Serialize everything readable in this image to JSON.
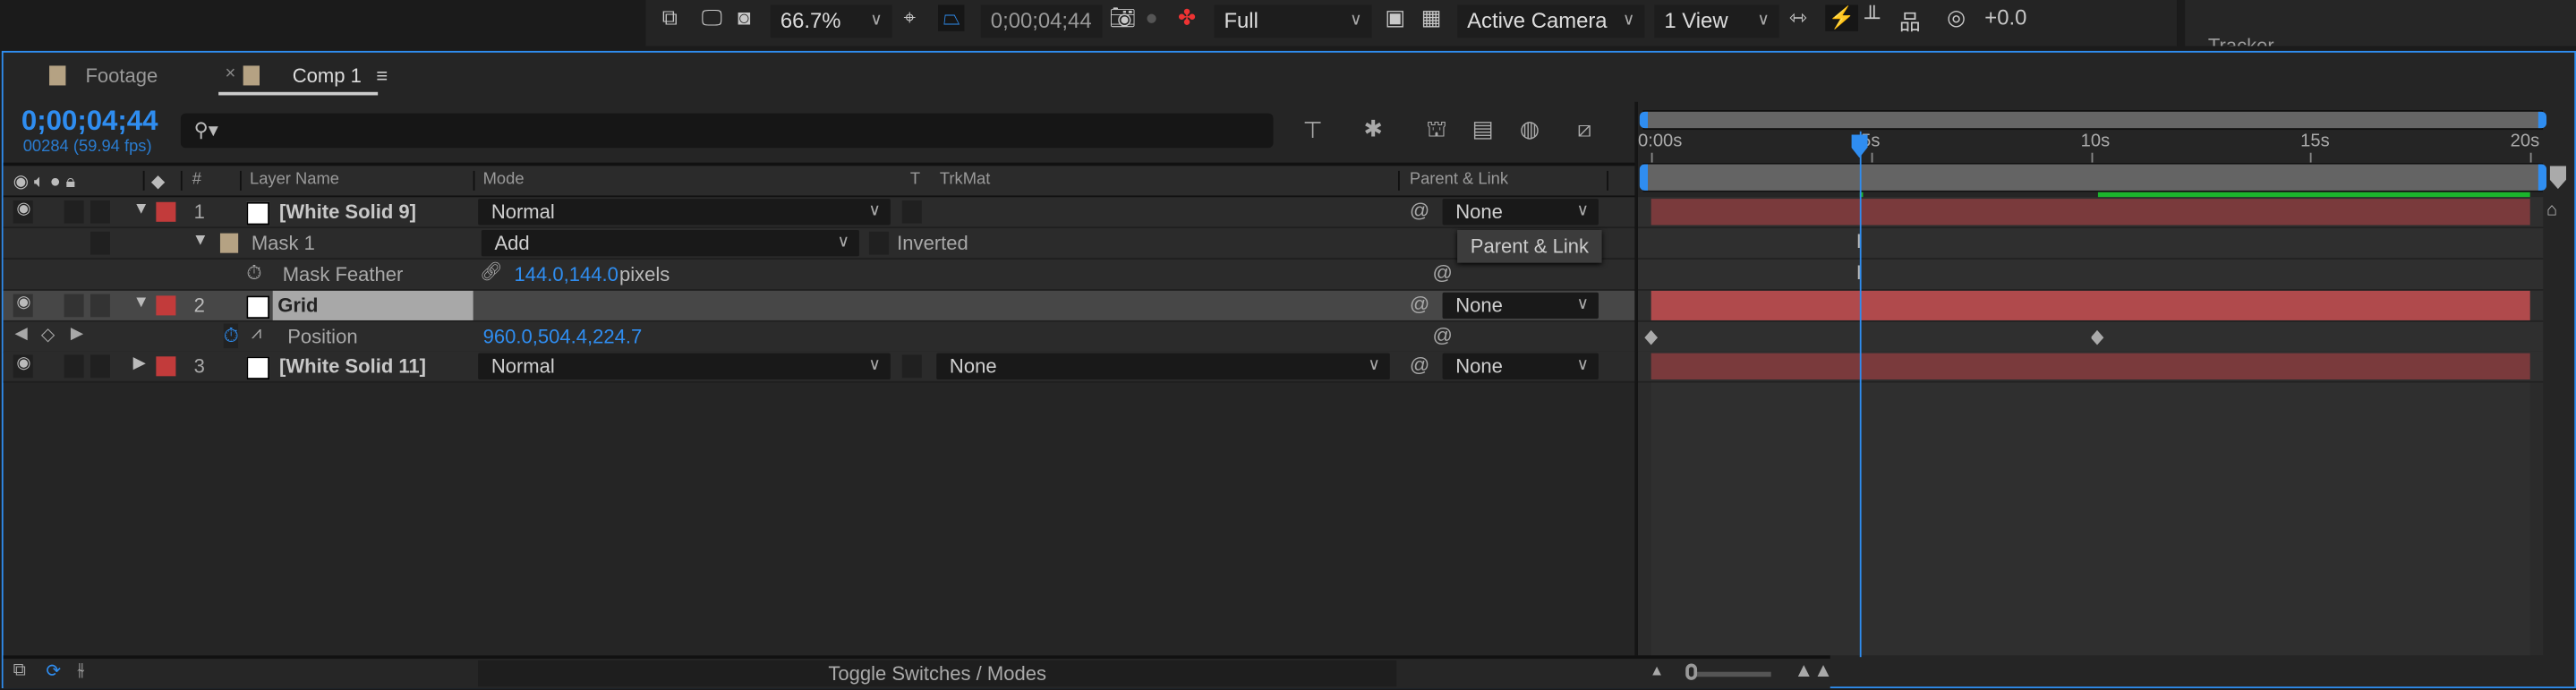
{
  "viewer_toolbar": {
    "zoom": "66.7%",
    "timecode": "0;00;04;44",
    "resolution": "Full",
    "camera": "Active Camera",
    "views": "1 View",
    "exposure": "+0.0",
    "icons": [
      "always-preview-icon",
      "monitor-icon",
      "mask-visibility-icon",
      "region-of-interest-icon",
      "transparency-grid-icon",
      "snapshot-icon",
      "show-snapshot-icon",
      "color-channels-icon",
      "toggle-pixel-aspect-icon",
      "checkerboard-icon",
      "3d-view-icon",
      "fast-previews-icon",
      "timeline-icon",
      "flowchart-icon",
      "exposure-icon"
    ]
  },
  "right_panel": {
    "title": "Tracker"
  },
  "tabs": [
    {
      "label": "Footage",
      "swatch": "#b5a283",
      "active": false
    },
    {
      "label": "Comp 1",
      "swatch": "#b5a283",
      "active": true,
      "close": "×",
      "menu": "≡"
    }
  ],
  "timecode": {
    "current": "0;00;04;44",
    "frames": "00284 (59.94 fps)"
  },
  "search": {
    "placeholder": "",
    "value": ""
  },
  "columns": {
    "hash": "#",
    "layer_name": "Layer Name",
    "mode": "Mode",
    "t": "T",
    "trkmat": "TrkMat",
    "parent": "Parent & Link"
  },
  "layers": [
    {
      "index": "1",
      "name": "[White Solid 9]",
      "mode": "Normal",
      "parent": "None",
      "label_color": "#c23b3b",
      "expanded": true,
      "mask": {
        "name": "Mask 1",
        "mode": "Add",
        "inverted": "Inverted",
        "property": "Mask Feather",
        "value": "144.0,144.0",
        "unit": "pixels"
      }
    },
    {
      "index": "2",
      "name": "Grid",
      "parent": "None",
      "label_color": "#c23b3b",
      "expanded": true,
      "selected": true,
      "property": {
        "name": "Position",
        "value": "960.0,504.4,224.7"
      }
    },
    {
      "index": "3",
      "name": "[White Solid 11]",
      "mode": "Normal",
      "trkmat": "None",
      "parent": "None",
      "label_color": "#c23b3b",
      "expanded": false
    }
  ],
  "tooltip": "Parent & Link",
  "timeline": {
    "ruler_labels": [
      "0:00s",
      "5s",
      "10s",
      "15s",
      "20s"
    ],
    "duration_s": 20,
    "playhead_s": 4.74,
    "rendered_from_s": 10.15,
    "position_keyframes_s": [
      0,
      10.15
    ],
    "layer_bar_color": "#7a3a3c",
    "selected_bar_color": "#b04a4c",
    "accent": "#2f8df0"
  },
  "bottom": {
    "toggle_label": "Toggle Switches / Modes"
  }
}
